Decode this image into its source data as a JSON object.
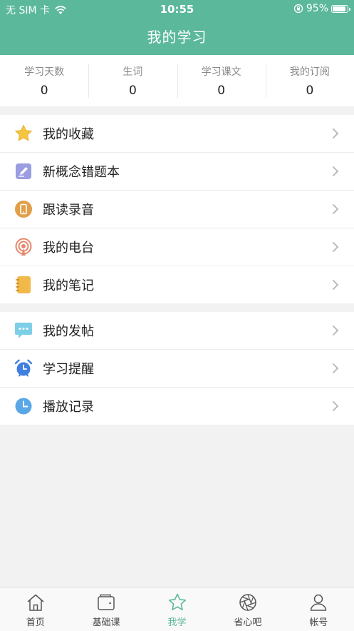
{
  "status_bar": {
    "carrier": "无 SIM 卡",
    "time": "10:55",
    "battery": "95%",
    "battery_level": 0.95
  },
  "header": {
    "title": "我的学习"
  },
  "stats": [
    {
      "label": "学习天数",
      "value": "0"
    },
    {
      "label": "生词",
      "value": "0"
    },
    {
      "label": "学习课文",
      "value": "0"
    },
    {
      "label": "我的订阅",
      "value": "0"
    }
  ],
  "menu_group_1": [
    {
      "label": "我的收藏",
      "icon": "star-icon",
      "color": "#f5c542"
    },
    {
      "label": "新概念错题本",
      "icon": "edit-icon",
      "color": "#9a9de0"
    },
    {
      "label": "跟读录音",
      "icon": "phone-icon",
      "color": "#e0a04a"
    },
    {
      "label": "我的电台",
      "icon": "radio-icon",
      "color": "#e5876a"
    },
    {
      "label": "我的笔记",
      "icon": "notebook-icon",
      "color": "#f1b84a"
    }
  ],
  "menu_group_2": [
    {
      "label": "我的发帖",
      "icon": "chat-icon",
      "color": "#7dcfe8"
    },
    {
      "label": "学习提醒",
      "icon": "alarm-icon",
      "color": "#3f7fe0"
    },
    {
      "label": "播放记录",
      "icon": "clock-icon",
      "color": "#5aa7e8"
    }
  ],
  "tabbar": {
    "tabs": [
      {
        "label": "首页",
        "icon": "home-icon"
      },
      {
        "label": "基础课",
        "icon": "wallet-icon"
      },
      {
        "label": "我学",
        "icon": "star-outline-icon",
        "active": true
      },
      {
        "label": "省心吧",
        "icon": "aperture-icon"
      },
      {
        "label": "帐号",
        "icon": "person-icon"
      }
    ],
    "active_color": "#5bb89b"
  },
  "colors": {
    "brand": "#5bb89b",
    "background": "#f2f2f2"
  }
}
